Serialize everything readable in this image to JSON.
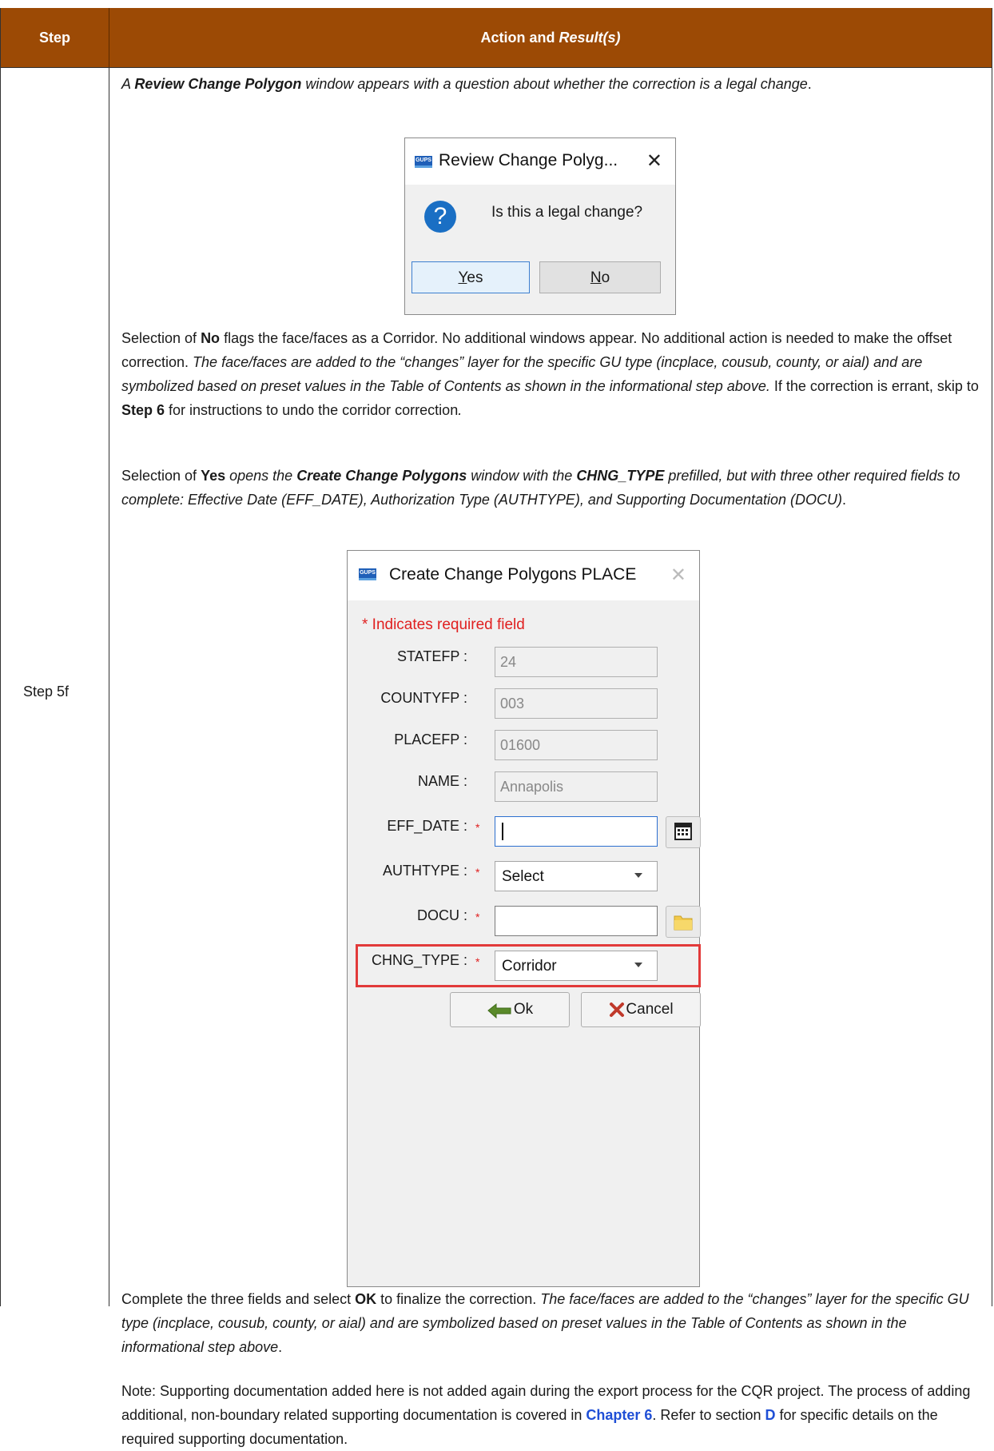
{
  "table": {
    "header_step": "Step",
    "header_action": "Action and ",
    "header_action_italic": "Result(s)",
    "step_label": "Step 5f"
  },
  "p1": {
    "t1": "A ",
    "b1": "Review Change Polygon",
    "t2": " window appears with a question about whether the correction is a legal change",
    "t3": "."
  },
  "dialog_review": {
    "title": "Review Change Polyg...",
    "app_badge": "GUPS",
    "close": "✕",
    "question_icon": "?",
    "message": "Is this a legal change?",
    "yes_underline": "Y",
    "yes_rest": "es",
    "no_underline": "N",
    "no_rest": "o"
  },
  "p2": {
    "t1": "Selection of ",
    "b1": "No",
    "t2": " flags the face/faces as a Corridor. No additional windows appear. No additional action is needed to make the offset correction. ",
    "i1": "The face/faces are added to the “changes” layer for the specific GU type (incplace, cousub, county, or aial) and are symbolized based on preset values in the Table of Contents as shown in the informational step above.",
    "t3": " If the correction is errant, skip to ",
    "b2": "Step 6",
    "t4": " for instructions to undo the corridor correction",
    "i2": "."
  },
  "p3": {
    "t1": "Selection of ",
    "b1": "Yes",
    "i1": " opens the ",
    "bi1": "Create Change Polygons",
    "i2": " window with the ",
    "bi2": "CHNG_TYPE",
    "i3": " prefilled, but with three other required fields to complete: Effective Date (EFF_DATE), Authorization Type (AUTHTYPE), and Supporting Documentation (DOCU)",
    "t2": "."
  },
  "dialog_create": {
    "title": "Create Change Polygons PLACE",
    "app_badge": "GUPS",
    "close": "✕",
    "required_note": "* Indicates required field",
    "fields": {
      "statefp_label": "STATEFP :",
      "statefp_value": "24",
      "countyfp_label": "COUNTYFP :",
      "countyfp_value": "003",
      "placefp_label": "PLACEFP :",
      "placefp_value": "01600",
      "name_label": "NAME :",
      "name_value": "Annapolis",
      "eff_date_label": "EFF_DATE :",
      "authtype_label": "AUTHTYPE :",
      "authtype_value": "Select",
      "docu_label": "DOCU :",
      "chng_type_label": "CHNG_TYPE :",
      "chng_type_value": "Corridor",
      "required_mark": "*"
    },
    "ok_label": "Ok",
    "cancel_label": "Cancel",
    "icons": [
      "calendar-icon",
      "folder-icon",
      "ok-arrow-icon",
      "cancel-x-icon"
    ]
  },
  "p4": {
    "t1": "Complete the three fields and select ",
    "b1": "OK",
    "t2": " to finalize the correction. ",
    "i1": "The face/faces are added to the “changes” layer for the specific GU type (incplace, cousub, county, or aial) and are symbolized based on preset values in the Table of Contents as shown in the informational step above",
    "t3": "."
  },
  "p5": {
    "t1": "Note: Supporting documentation added here is not added again during the export process for the CQR project. The process of adding additional, non-boundary related supporting documentation is covered in ",
    "link1": "Chapter 6",
    "t2": ". Refer to section ",
    "link2": "D",
    "t3": " for specific details on the required supporting documentation."
  },
  "colors": {
    "header_bg": "#9c4a05",
    "link": "#1f4fd6",
    "required_red": "#e02020",
    "highlight_box": "#e23a3a"
  }
}
